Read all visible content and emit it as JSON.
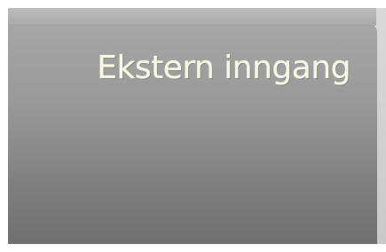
{
  "panel": {
    "title": "Ekstern inngang"
  }
}
